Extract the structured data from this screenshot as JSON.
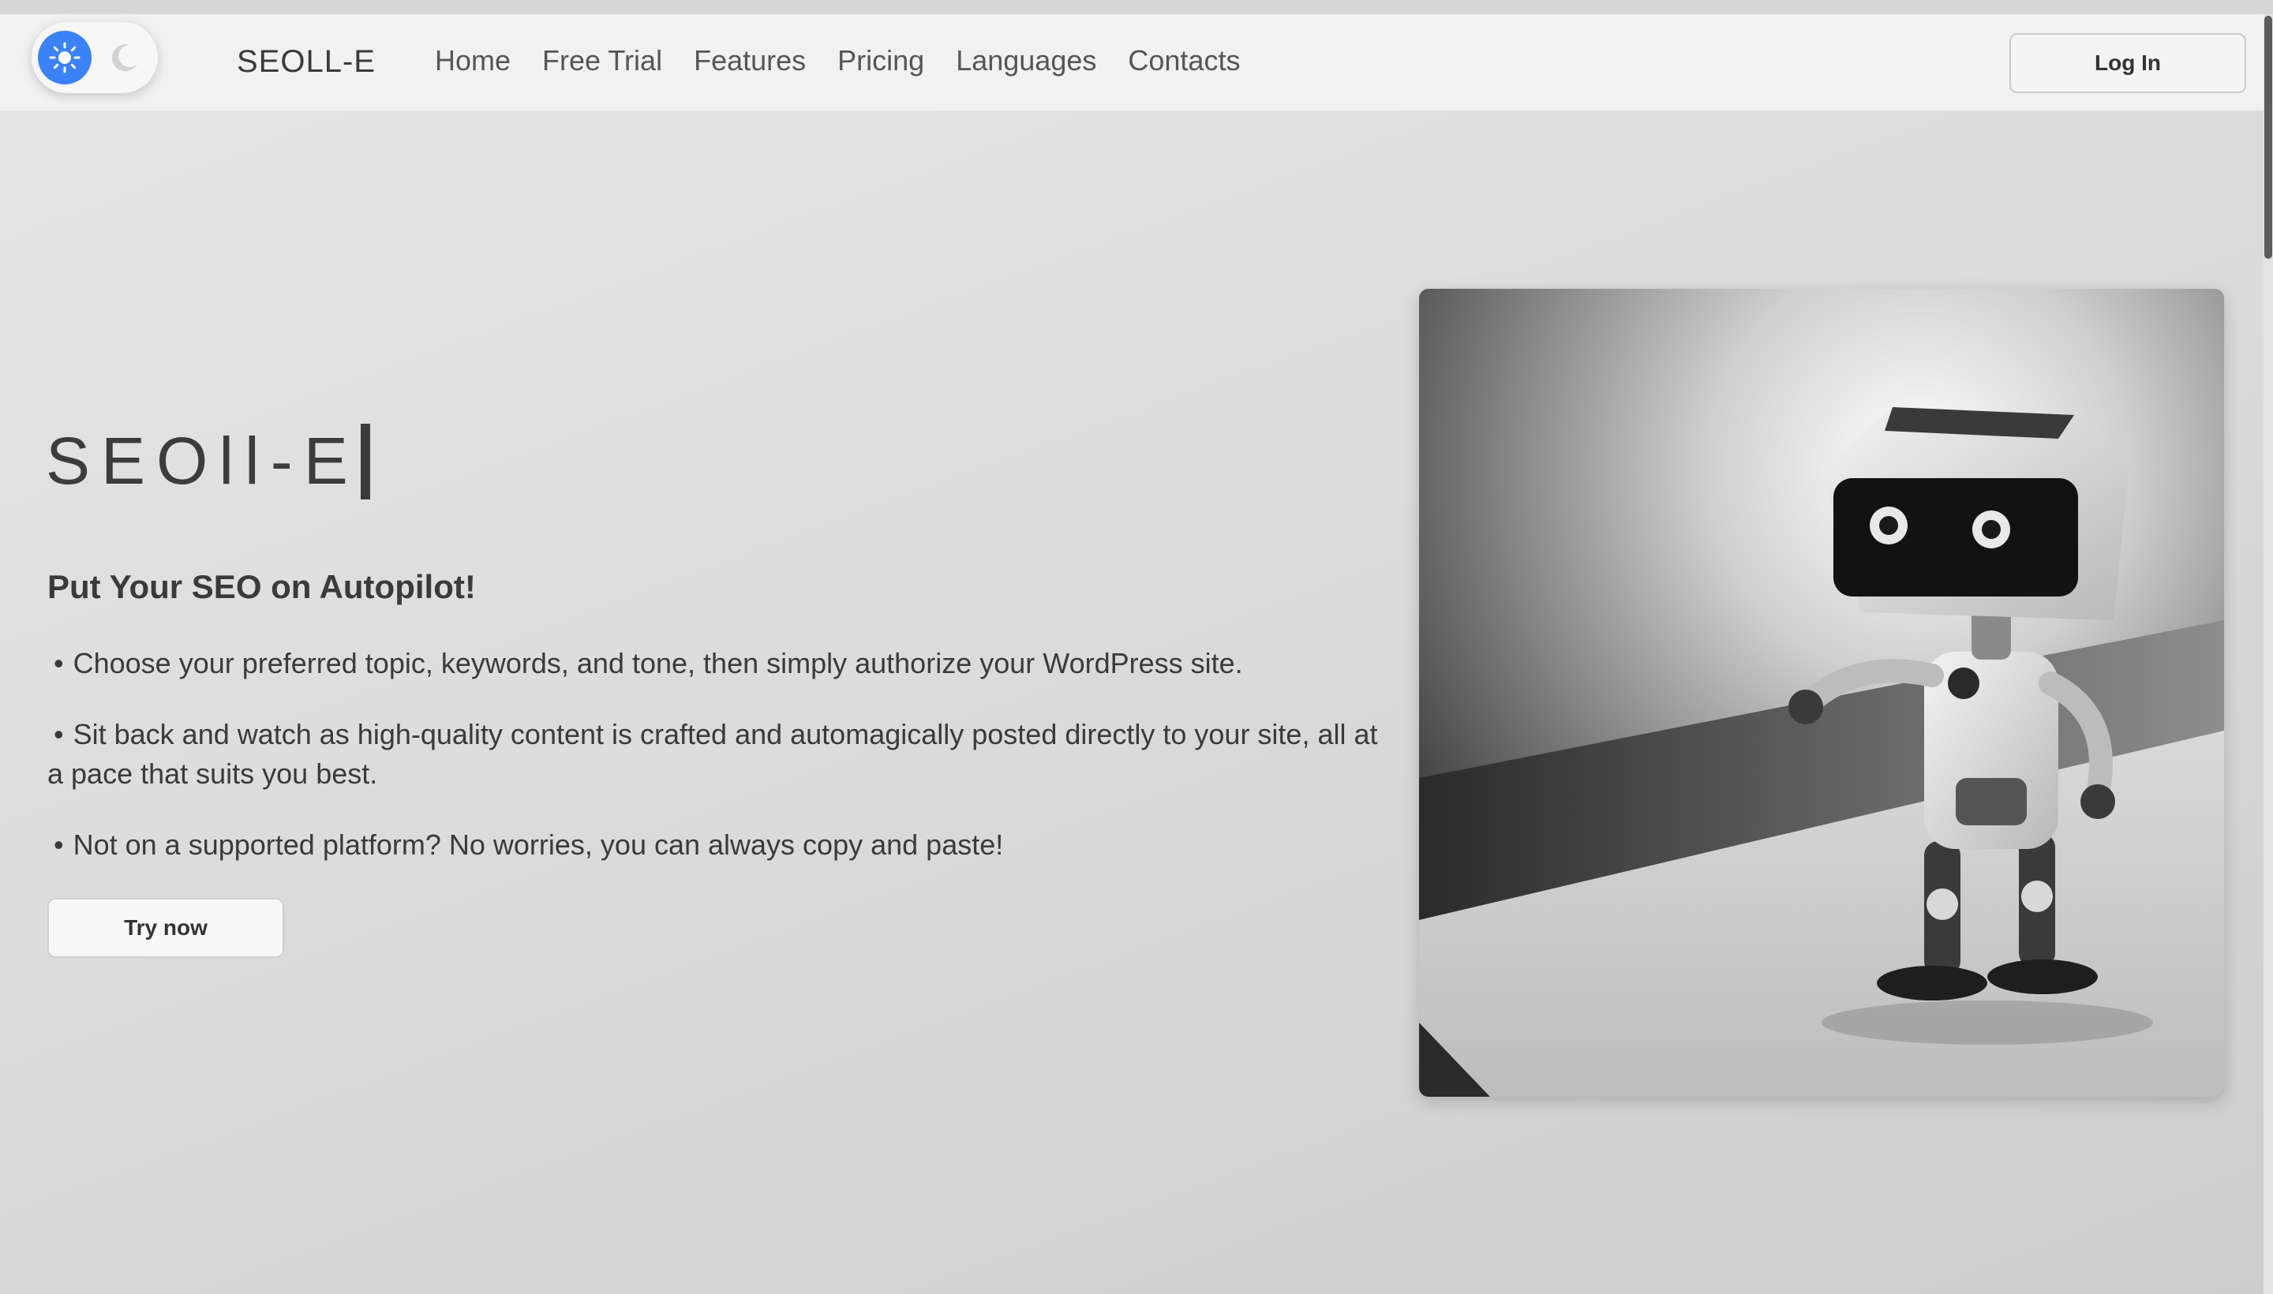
{
  "nav": {
    "brand": "SEOLL-E",
    "links": [
      "Home",
      "Free Trial",
      "Features",
      "Pricing",
      "Languages",
      "Contacts"
    ],
    "login_label": "Log In",
    "theme_toggle": {
      "active": "light",
      "light_icon": "sun-icon",
      "dark_icon": "moon-icon",
      "accent": "#3b82f6"
    }
  },
  "hero": {
    "title": "SEOll-E",
    "subtitle": "Put Your SEO on Autopilot!",
    "bullets": [
      "Choose your preferred topic, keywords, and tone, then simply authorize your WordPress site.",
      "Sit back and watch as high-quality content is crafted and automagically posted directly to your site, all at a pace that suits you best.",
      "Not on a supported platform? No worries, you can always copy and paste!"
    ],
    "bullet_symbol": "•",
    "cta_label": "Try now"
  }
}
